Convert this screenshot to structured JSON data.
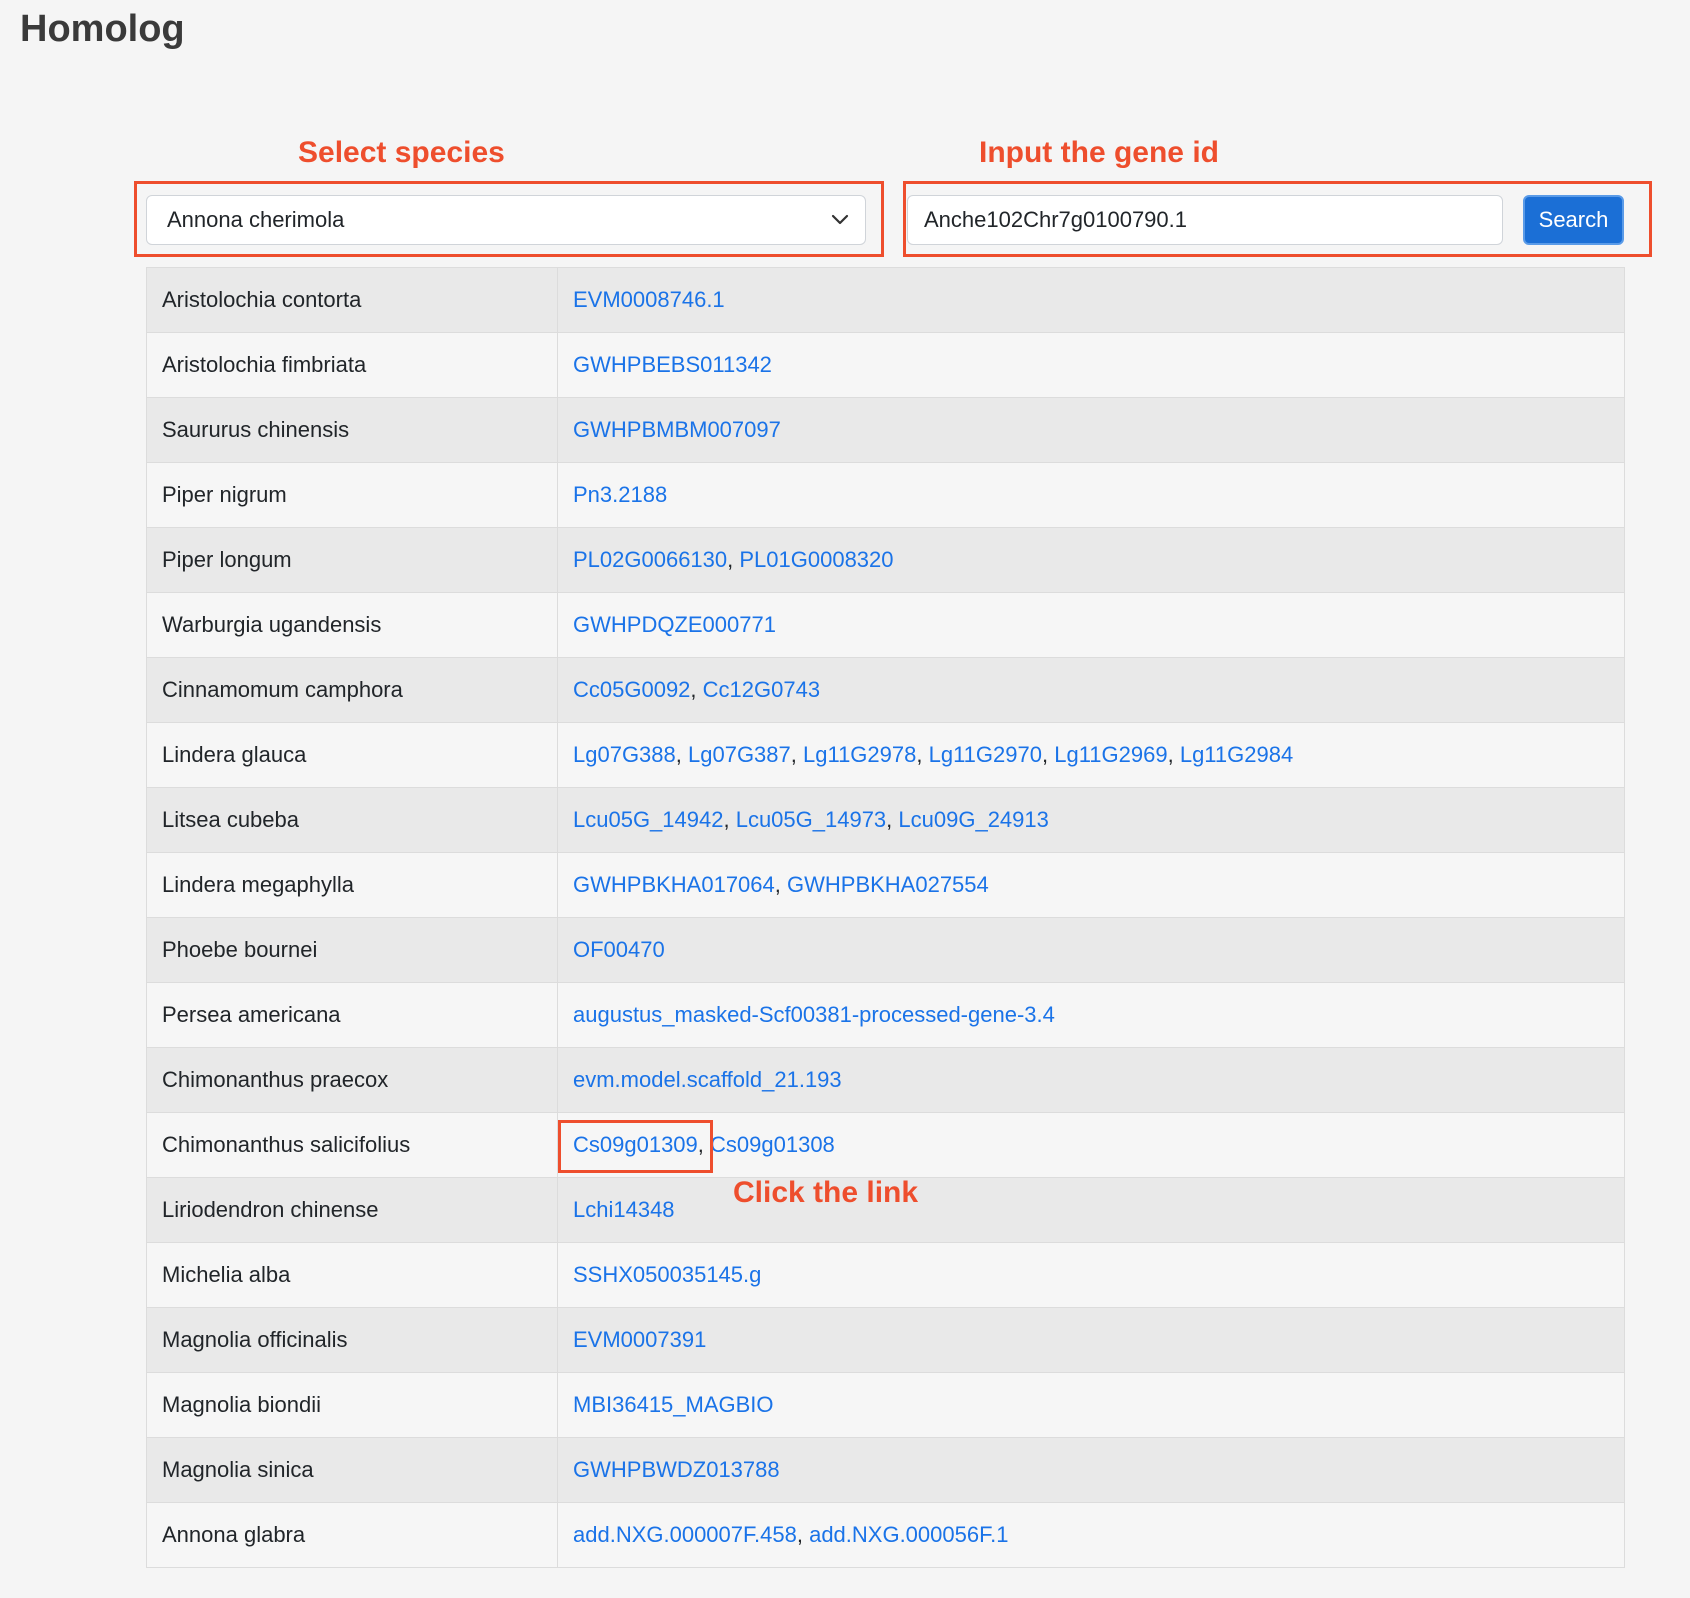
{
  "page": {
    "title": "Homolog"
  },
  "annotations": {
    "select_species": "Select species",
    "input_gene": "Input the gene id",
    "click_link": "Click the link"
  },
  "search": {
    "species_selected": "Annona cherimola",
    "gene_id": "Anche102Chr7g0100790.1",
    "button_label": "Search"
  },
  "colors": {
    "annotation": "#ee4e2d",
    "link": "#1a73e8",
    "button": "#1b6fd6"
  },
  "rows": [
    {
      "species": "Aristolochia contorta",
      "genes": [
        "EVM0008746.1"
      ]
    },
    {
      "species": "Aristolochia fimbriata",
      "genes": [
        "GWHPBEBS011342"
      ]
    },
    {
      "species": "Saururus chinensis",
      "genes": [
        "GWHPBMBM007097"
      ]
    },
    {
      "species": "Piper nigrum",
      "genes": [
        "Pn3.2188"
      ]
    },
    {
      "species": "Piper longum",
      "genes": [
        "PL02G0066130",
        "PL01G0008320"
      ]
    },
    {
      "species": "Warburgia ugandensis",
      "genes": [
        "GWHPDQZE000771"
      ]
    },
    {
      "species": "Cinnamomum camphora",
      "genes": [
        "Cc05G0092",
        "Cc12G0743"
      ]
    },
    {
      "species": "Lindera glauca",
      "genes": [
        "Lg07G388",
        "Lg07G387",
        "Lg11G2978",
        "Lg11G2970",
        "Lg11G2969",
        "Lg11G2984"
      ]
    },
    {
      "species": "Litsea cubeba",
      "genes": [
        "Lcu05G_14942",
        "Lcu05G_14973",
        "Lcu09G_24913"
      ]
    },
    {
      "species": "Lindera megaphylla",
      "genes": [
        "GWHPBKHA017064",
        "GWHPBKHA027554"
      ]
    },
    {
      "species": "Phoebe bournei",
      "genes": [
        "OF00470"
      ]
    },
    {
      "species": "Persea americana",
      "genes": [
        "augustus_masked-Scf00381-processed-gene-3.4"
      ]
    },
    {
      "species": "Chimonanthus praecox",
      "genes": [
        "evm.model.scaffold_21.193"
      ]
    },
    {
      "species": "Chimonanthus salicifolius",
      "genes": [
        "Cs09g01309",
        "Cs09g01308"
      ]
    },
    {
      "species": "Liriodendron chinense",
      "genes": [
        "Lchi14348"
      ]
    },
    {
      "species": "Michelia alba",
      "genes": [
        "SSHX050035145.g"
      ]
    },
    {
      "species": "Magnolia officinalis",
      "genes": [
        "EVM0007391"
      ]
    },
    {
      "species": "Magnolia biondii",
      "genes": [
        "MBI36415_MAGBIO"
      ]
    },
    {
      "species": "Magnolia sinica",
      "genes": [
        "GWHPBWDZ013788"
      ]
    },
    {
      "species": "Annona glabra",
      "genes": [
        "add.NXG.000007F.458",
        "add.NXG.000056F.1"
      ]
    }
  ]
}
